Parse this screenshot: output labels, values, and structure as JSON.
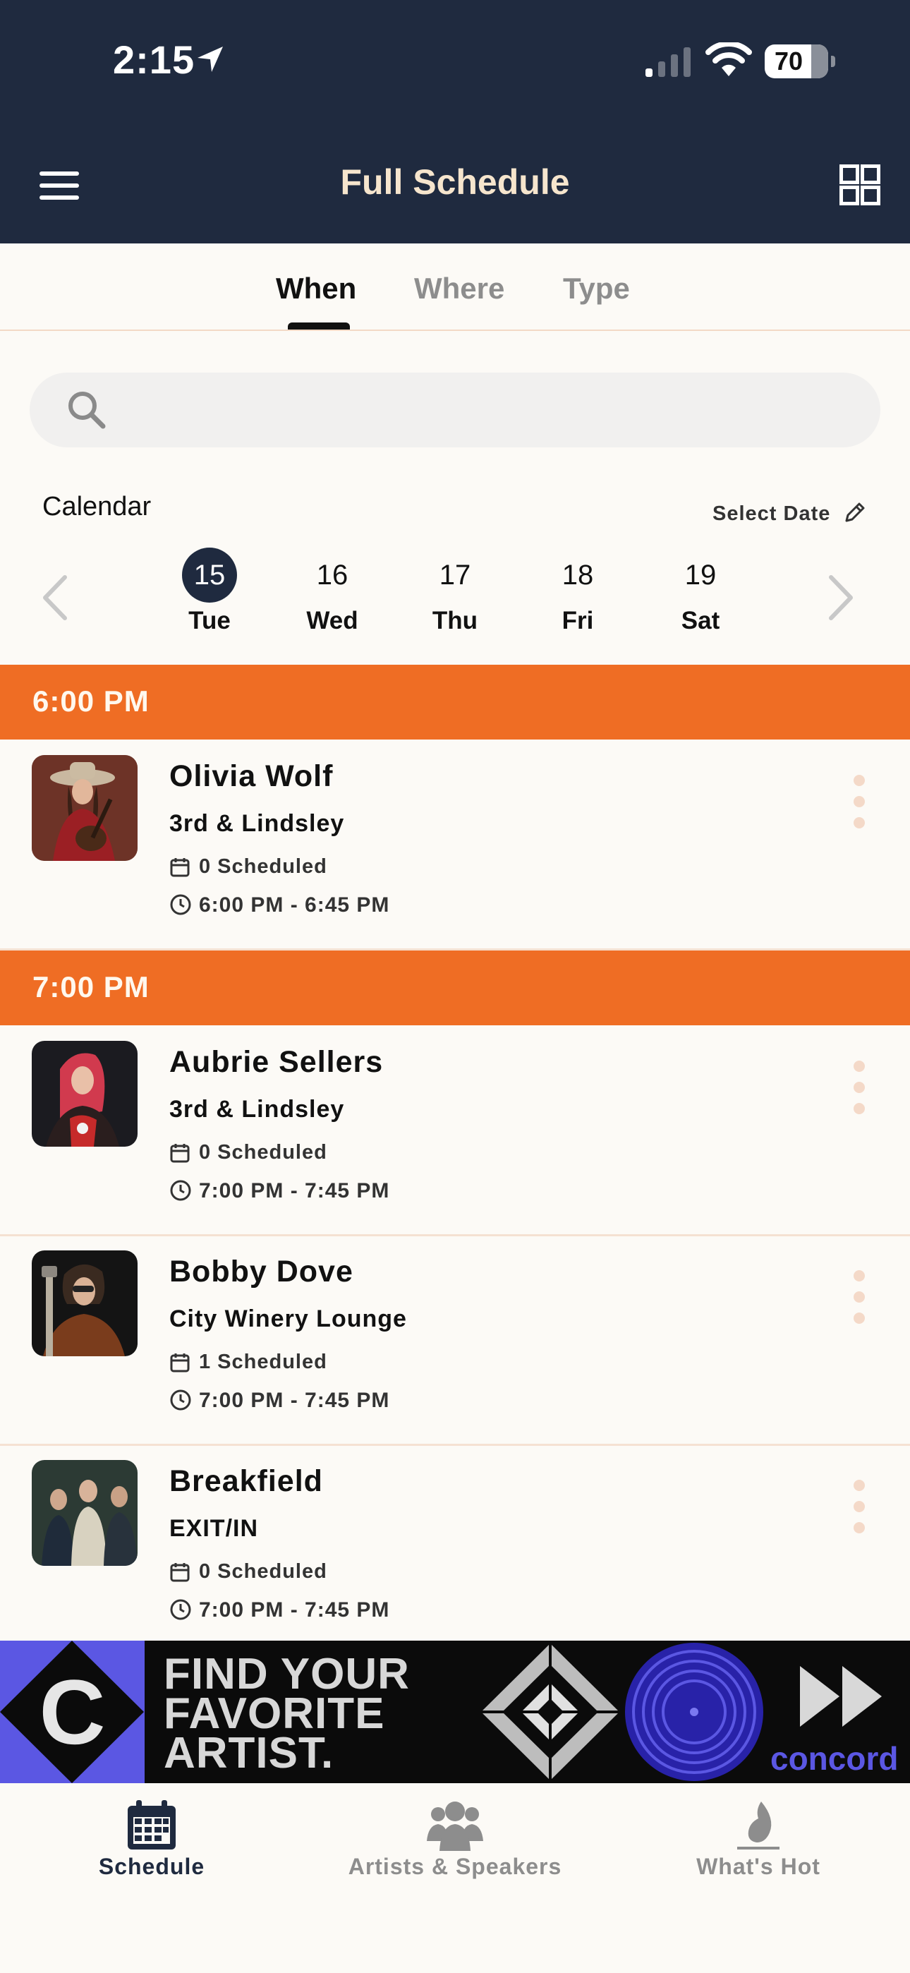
{
  "status_bar": {
    "time": "2:15",
    "battery": "70"
  },
  "header": {
    "title": "Full Schedule"
  },
  "tabs": [
    {
      "label": "When"
    },
    {
      "label": "Where"
    },
    {
      "label": "Type"
    }
  ],
  "search": {
    "placeholder": ""
  },
  "calendar": {
    "label": "Calendar",
    "select_date": "Select Date",
    "days": [
      {
        "num": "15",
        "dow": "Tue",
        "selected": true
      },
      {
        "num": "16",
        "dow": "Wed"
      },
      {
        "num": "17",
        "dow": "Thu"
      },
      {
        "num": "18",
        "dow": "Fri"
      },
      {
        "num": "19",
        "dow": "Sat"
      }
    ]
  },
  "time_slots": [
    {
      "label": "6:00 PM"
    },
    {
      "label": "7:00 PM"
    }
  ],
  "events": [
    {
      "name": "Olivia Wolf",
      "venue": "3rd & Lindsley",
      "scheduled": "0 Scheduled",
      "time": "6:00 PM - 6:45 PM"
    },
    {
      "name": "Aubrie Sellers",
      "venue": "3rd & Lindsley",
      "scheduled": "0 Scheduled",
      "time": "7:00 PM - 7:45 PM"
    },
    {
      "name": "Bobby Dove",
      "venue": "City Winery Lounge",
      "scheduled": "1 Scheduled",
      "time": "7:00 PM - 7:45 PM"
    },
    {
      "name": "Breakfield",
      "venue": "EXIT/IN",
      "scheduled": "0 Scheduled",
      "time": "7:00 PM - 7:45 PM"
    }
  ],
  "banner": {
    "line1": "FIND YOUR",
    "line2": "FAVORITE",
    "line3": "ARTIST.",
    "brand": "concord",
    "logo_letter": "C"
  },
  "bottom_nav": [
    {
      "label": "Schedule",
      "icon": "calendar-icon",
      "active": true
    },
    {
      "label": "Artists & Speakers",
      "icon": "people-icon"
    },
    {
      "label": "What's Hot",
      "icon": "flame-icon"
    }
  ],
  "colors": {
    "navy": "#1f2a3f",
    "accent_orange": "#ef6d24",
    "title_cream": "#f6e5cd",
    "banner_blue": "#5b57e3"
  }
}
